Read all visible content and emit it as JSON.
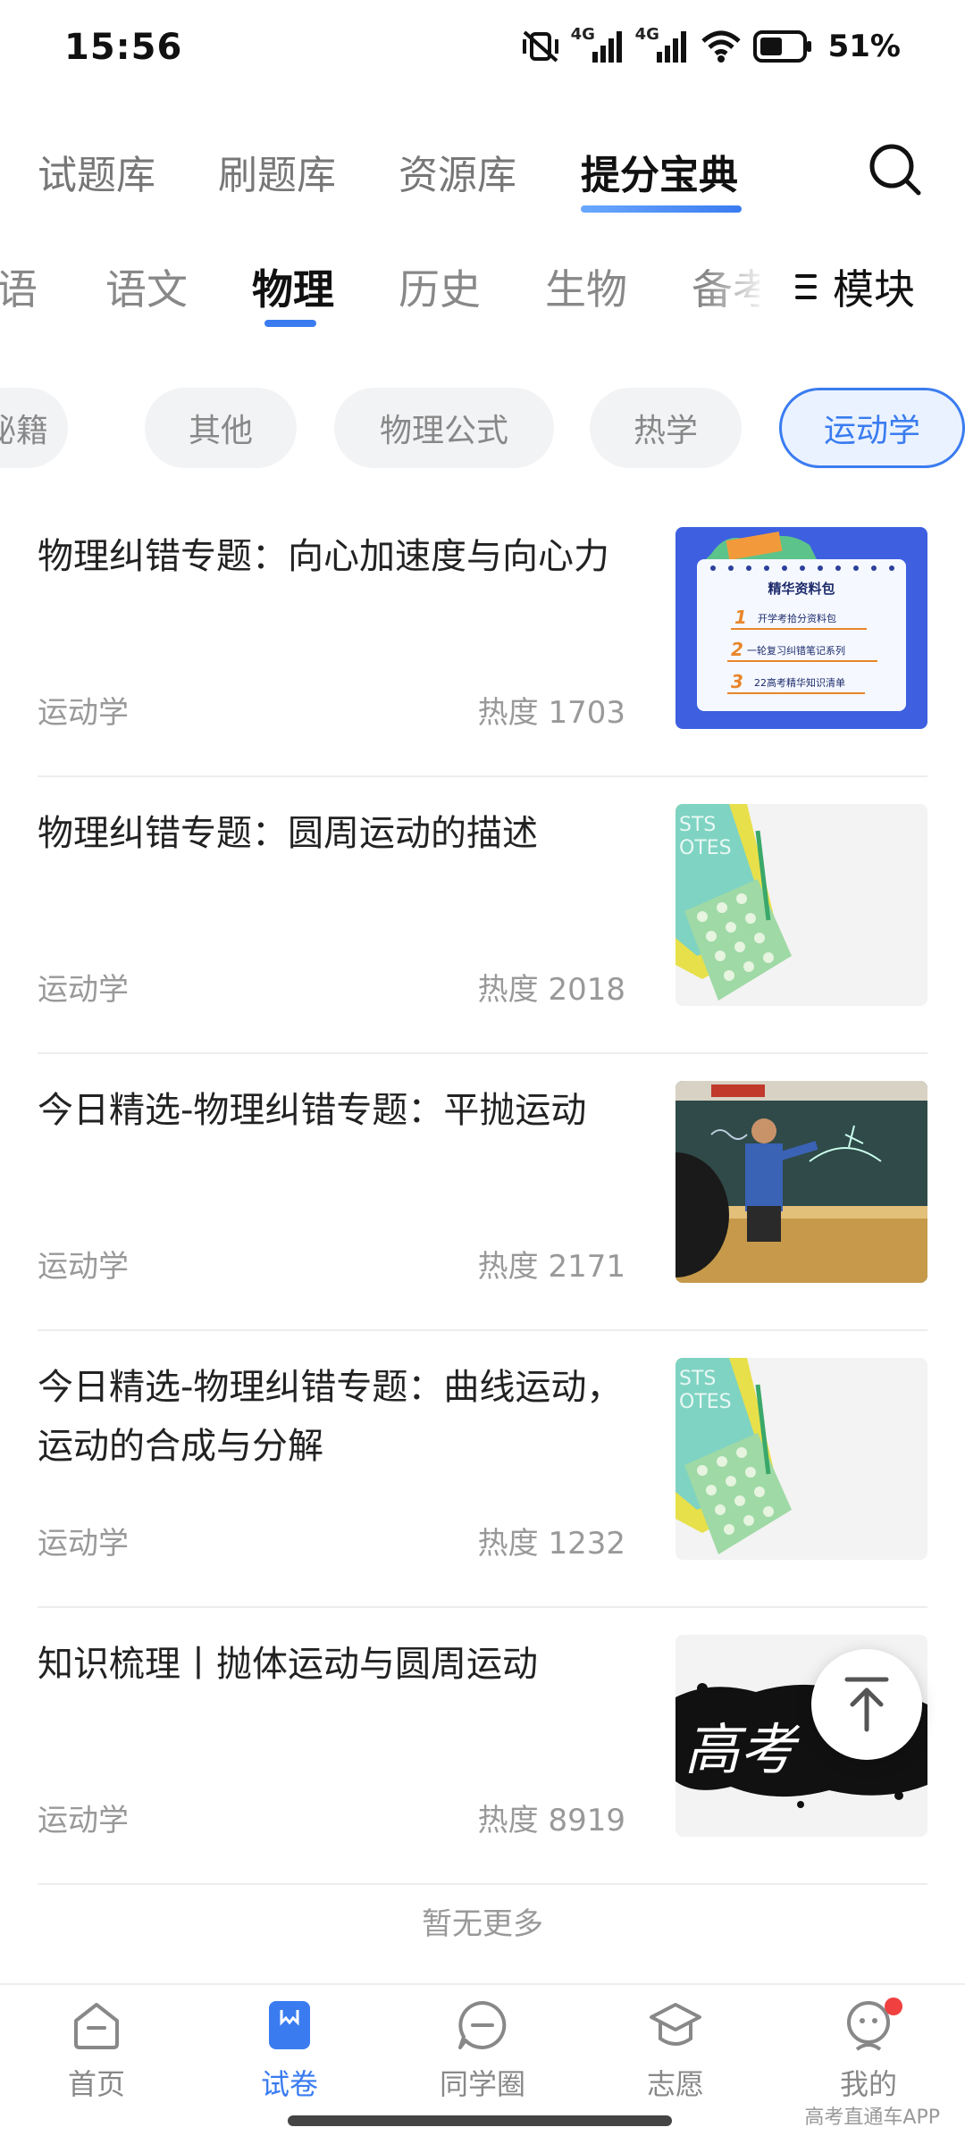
{
  "status_bar": {
    "time": "15:56",
    "network1": "4G",
    "network2": "4G",
    "battery": "51%"
  },
  "top_tabs": [
    "试题库",
    "刷题库",
    "资源库",
    "提分宝典"
  ],
  "top_tab_active": "提分宝典",
  "subject_tabs": [
    "语",
    "语文",
    "物理",
    "历史",
    "生物",
    "备考"
  ],
  "subject_active": "物理",
  "module_label": "模块",
  "chips": [
    "秘籍",
    "其他",
    "物理公式",
    "热学",
    "运动学"
  ],
  "chip_active": "运动学",
  "items": [
    {
      "title": "物理纠错专题：向心加速度与向心力",
      "tag": "运动学",
      "heat": "热度 1703",
      "thumb": "poster-card"
    },
    {
      "title": "物理纠错专题：圆周运动的描述",
      "tag": "运动学",
      "heat": "热度 2018",
      "thumb": "notebook-photo"
    },
    {
      "title": "今日精选-物理纠错专题：平抛运动",
      "tag": "运动学",
      "heat": "热度 2171",
      "thumb": "classroom-photo"
    },
    {
      "title": "今日精选-物理纠错专题：曲线运动，运动的合成与分解",
      "tag": "运动学",
      "heat": "热度 1232",
      "thumb": "notebook-photo"
    },
    {
      "title": "知识梳理丨抛体运动与圆周运动",
      "tag": "运动学",
      "heat": "热度 8919",
      "thumb": "ink-calligraphy"
    }
  ],
  "poster": {
    "title": "精华资料包",
    "lines": [
      "开学考拾分资料包",
      "一轮复习纠错笔记系列",
      "22高考精华知识清单"
    ],
    "numbers": [
      "1",
      "2",
      "3"
    ]
  },
  "thumb_text": {
    "notebook": "STS\nOTES",
    "calligraphy": "高考"
  },
  "no_more": "暂无更多",
  "bottom_nav": [
    {
      "label": "首页",
      "icon": "home-icon",
      "active": false
    },
    {
      "label": "试卷",
      "icon": "exam-paper-icon",
      "active": true
    },
    {
      "label": "同学圈",
      "icon": "chat-circle-icon",
      "active": false
    },
    {
      "label": "志愿",
      "icon": "graduation-cap-icon",
      "active": false
    },
    {
      "label": "我的",
      "icon": "profile-icon",
      "active": false
    }
  ],
  "watermark": "高考直通车APP",
  "colors": {
    "accent": "#3a7cf0",
    "badge": "#f04040"
  }
}
